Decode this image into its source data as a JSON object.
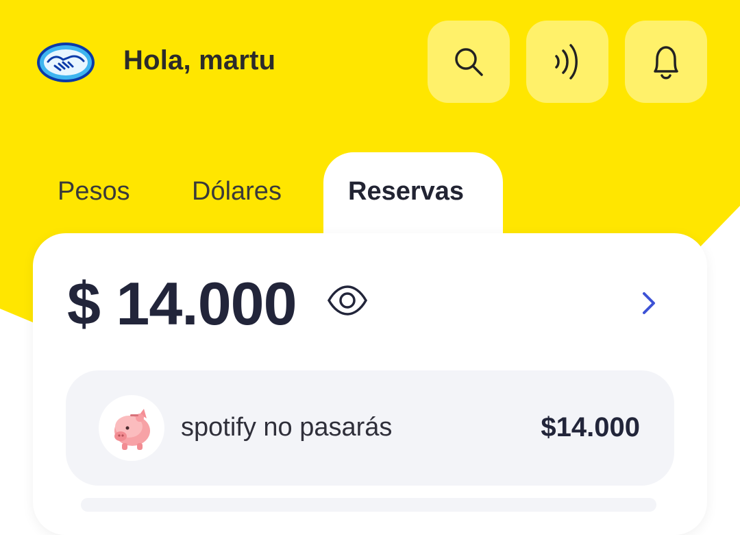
{
  "colors": {
    "brand_yellow": "#ffe600",
    "button_yellow": "#fff16a",
    "accent_blue": "#3d52d5",
    "text_dark": "#22253a"
  },
  "header": {
    "greeting": "Hola, martu",
    "buttons": [
      {
        "name": "search",
        "icon": "search-icon"
      },
      {
        "name": "contactless-pay",
        "icon": "contactless-icon"
      },
      {
        "name": "notifications",
        "icon": "bell-icon"
      }
    ]
  },
  "tabs": [
    {
      "label": "Pesos",
      "active": false
    },
    {
      "label": "Dólares",
      "active": false
    },
    {
      "label": "Reservas",
      "active": true
    }
  ],
  "balance": {
    "amount": "$ 14.000",
    "visibility_icon": "eye-icon",
    "detail_icon": "chevron-right-icon"
  },
  "reserves": [
    {
      "name": "spotify no pasarás",
      "amount": "$14.000",
      "icon": "piggy-bank-icon"
    }
  ]
}
